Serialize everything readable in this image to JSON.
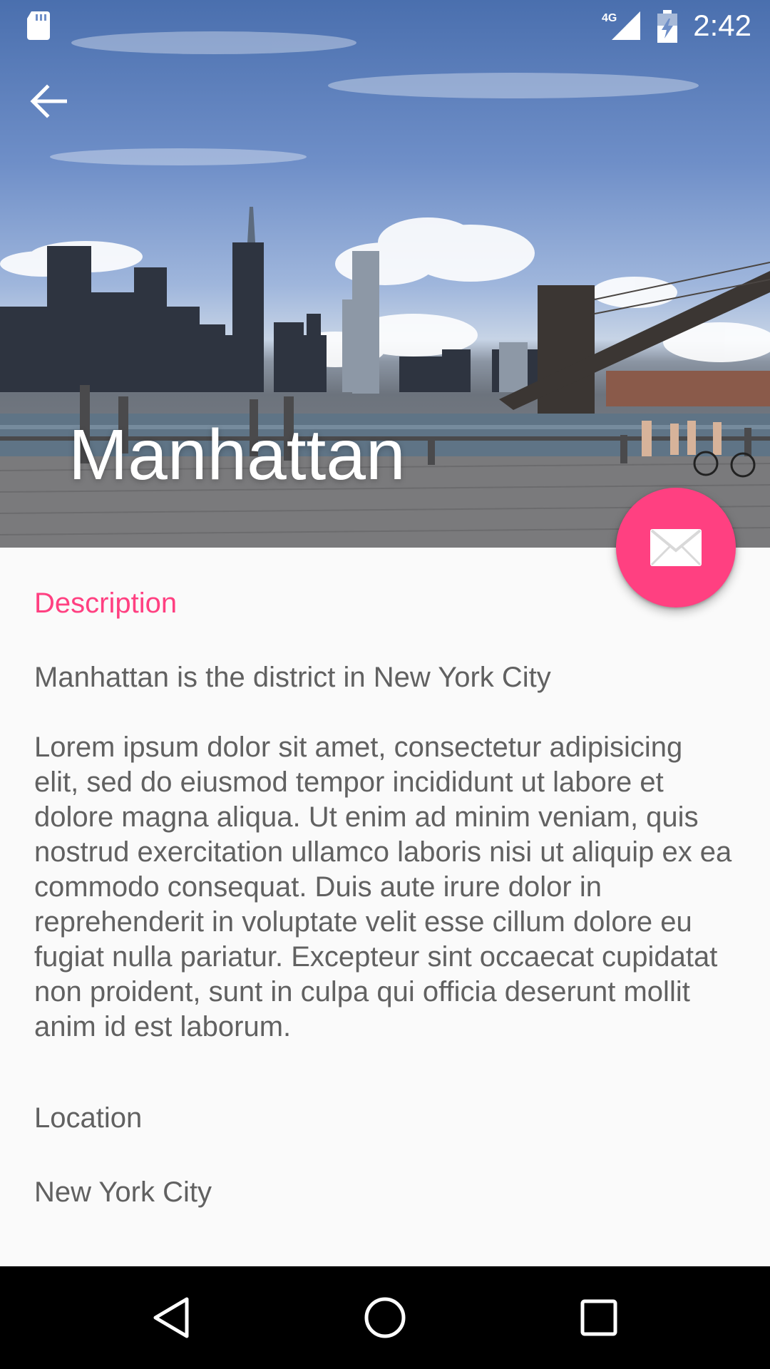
{
  "status_bar": {
    "time": "2:42",
    "network_label": "4G",
    "icons": [
      "sd-card-icon",
      "signal-4g-icon",
      "battery-charging-icon"
    ]
  },
  "app_bar": {
    "back_icon": "arrow-back-icon",
    "title": "Manhattan"
  },
  "fab": {
    "icon": "mail-icon",
    "color": "#ff4081"
  },
  "content": {
    "section_label": "Description",
    "summary": "Manhattan is the district in New York City",
    "body": "Lorem ipsum dolor sit amet, consectetur adipisicing elit, sed do eiusmod tempor incididunt ut labore et dolore magna aliqua. Ut enim ad minim veniam, quis nostrud exercitation ullamco laboris nisi ut aliquip ex ea commodo consequat. Duis aute irure dolor in reprehenderit in voluptate velit esse cillum dolore eu fugiat nulla pariatur. Excepteur sint occaecat cupidatat non proident, sunt in culpa qui officia deserunt mollit anim id est laborum.",
    "location_label": "Location",
    "location_value": "New York City"
  },
  "nav_bar": {
    "buttons": [
      "back-triangle-icon",
      "home-circle-icon",
      "recents-square-icon"
    ]
  },
  "colors": {
    "accent": "#ff4081",
    "text": "#616161",
    "background": "#fafafa"
  }
}
